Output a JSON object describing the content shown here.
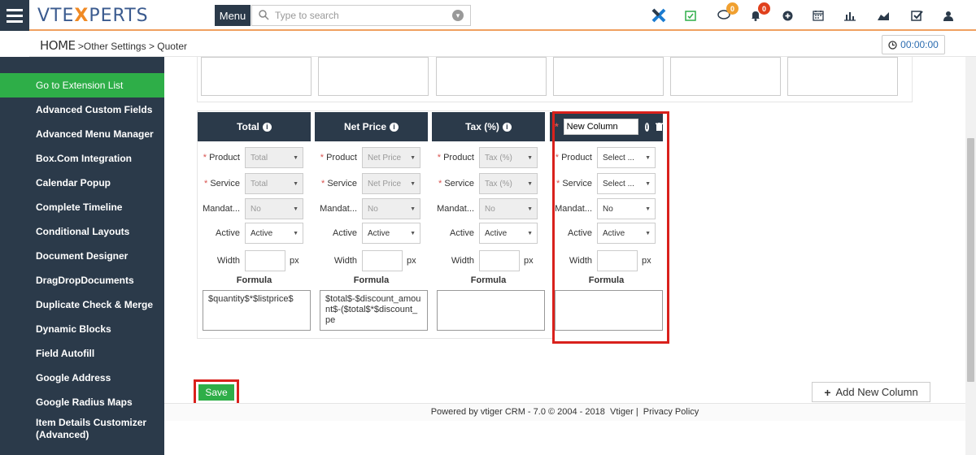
{
  "topbar": {
    "logo_left": "VTE",
    "logo_x": "X",
    "logo_right": "PERTS",
    "menu_label": "Menu",
    "search_placeholder": "Type to search",
    "chat_badge": "0",
    "bell_badge": "0",
    "icons": [
      "vtiger-x-icon",
      "calendar-check-icon",
      "chat-icon",
      "bell-icon",
      "plus-circle-icon",
      "calendar-icon",
      "bar-chart-icon",
      "area-chart-icon",
      "checkbox-icon",
      "user-icon"
    ],
    "accent": "#f0a060",
    "dark": "#2b3a4a"
  },
  "breadcrumb": {
    "home": "HOME",
    "sep1": ">",
    "level1": "Other Settings",
    "sep2": ">",
    "level2": "Quoter"
  },
  "timer": "00:00:00",
  "sidebar": {
    "items": [
      {
        "label": "Go to Extension List",
        "active": true
      },
      {
        "label": "Advanced Custom Fields"
      },
      {
        "label": "Advanced Menu Manager"
      },
      {
        "label": "Box.Com Integration"
      },
      {
        "label": "Calendar Popup"
      },
      {
        "label": "Complete Timeline"
      },
      {
        "label": "Conditional Layouts"
      },
      {
        "label": "Document Designer"
      },
      {
        "label": "DragDropDocuments"
      },
      {
        "label": "Duplicate Check & Merge"
      },
      {
        "label": "Dynamic Blocks"
      },
      {
        "label": "Field Autofill"
      },
      {
        "label": "Google Address"
      },
      {
        "label": "Google Radius Maps"
      },
      {
        "label": "Item Details Customizer (Advanced)"
      }
    ]
  },
  "columns": [
    {
      "header": "Total",
      "product_label": "Product",
      "product_value": "Total",
      "service_label": "Service",
      "service_value": "Total",
      "mandatory_label": "Mandat...",
      "mandatory_value": "No",
      "active_label": "Active",
      "active_value": "Active",
      "width_label": "Width",
      "width_unit": "px",
      "formula_label": "Formula",
      "formula": "$quantity$*$listprice$"
    },
    {
      "header": "Net Price",
      "product_label": "Product",
      "product_value": "Net Price",
      "service_label": "Service",
      "service_value": "Net Price",
      "mandatory_label": "Mandat...",
      "mandatory_value": "No",
      "active_label": "Active",
      "active_value": "Active",
      "width_label": "Width",
      "width_unit": "px",
      "formula_label": "Formula",
      "formula": "$total$-$discount_amount$-($total$*$discount_pe"
    },
    {
      "header": "Tax (%)",
      "product_label": "Product",
      "product_value": "Tax (%)",
      "service_label": "Service",
      "service_value": "Tax (%)",
      "mandatory_label": "Mandat...",
      "mandatory_value": "No",
      "active_label": "Active",
      "active_value": "Active",
      "width_label": "Width",
      "width_unit": "px",
      "formula_label": "Formula",
      "formula": ""
    },
    {
      "header": "New Column",
      "product_label": "Product",
      "product_value": "Select ...",
      "service_label": "Service",
      "service_value": "Select ...",
      "mandatory_label": "Mandat...",
      "mandatory_value": "No",
      "active_label": "Active",
      "active_value": "Active",
      "width_label": "Width",
      "width_unit": "px",
      "formula_label": "Formula",
      "formula": ""
    }
  ],
  "required_mark": "*",
  "info_glyph": "i",
  "save_label": "Save",
  "add_column_label": "Add New Column",
  "footer": {
    "powered": "Powered by vtiger CRM - 7.0  © 2004 - 2018",
    "vtiger_link": "Vtiger",
    "sep": "|",
    "privacy_link": "Privacy Policy"
  },
  "highlight_color": "#d9211c",
  "active_green": "#2eae48"
}
